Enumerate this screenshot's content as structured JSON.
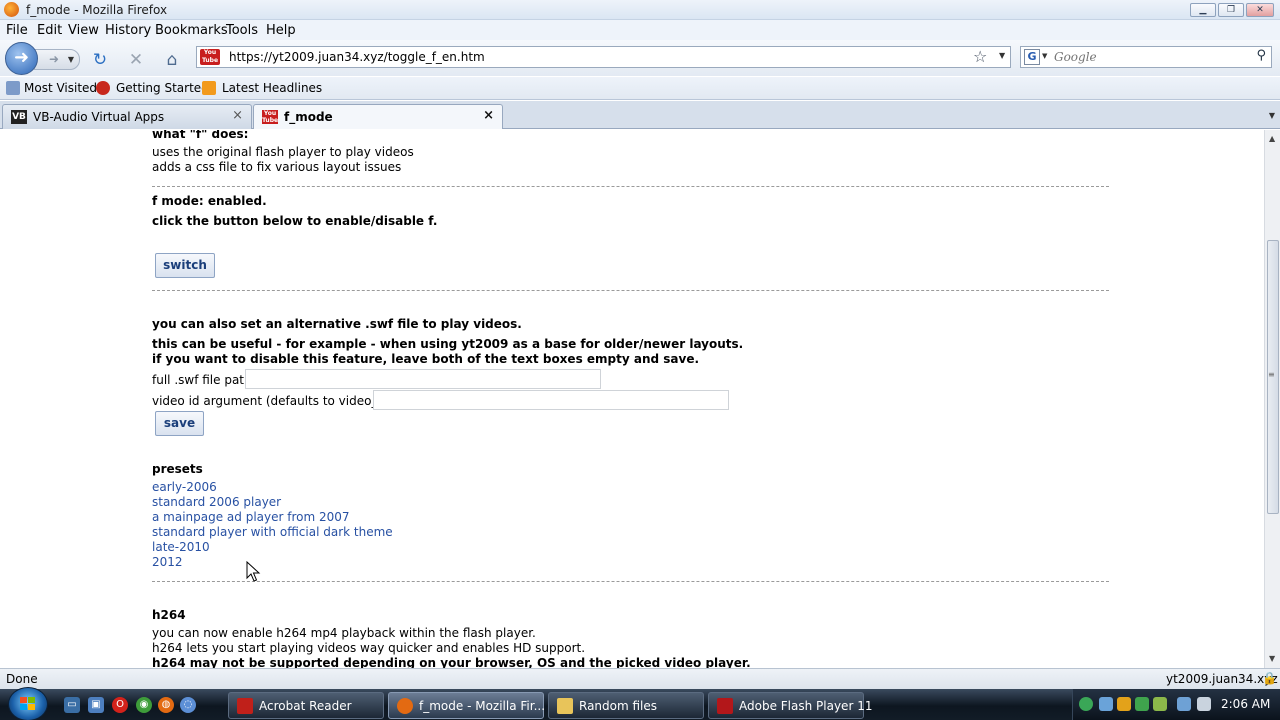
{
  "window": {
    "title": "f_mode - Mozilla Firefox"
  },
  "menu": [
    "File",
    "Edit",
    "View",
    "History",
    "Bookmarks",
    "Tools",
    "Help"
  ],
  "nav": {
    "url": "https://yt2009.juan34.xyz/toggle_f_en.htm",
    "search_placeholder": "Google",
    "favicon_text": "You Tube"
  },
  "bookmarks": [
    "Most Visited",
    "Getting Started",
    "Latest Headlines"
  ],
  "tabs": [
    {
      "label": "VB-Audio Virtual Apps",
      "icon": "VB"
    },
    {
      "label": "f_mode",
      "icon": "You Tube"
    }
  ],
  "content": {
    "what_f_does": "what \"f\" does:",
    "does_1": "uses the original flash player to play videos",
    "does_2": "adds a css file to fix various layout issues",
    "status": "f mode: enabled.",
    "instruction": "click the button below to enable/disable f.",
    "switch_label": "switch",
    "alt_heading": "you can also set an alternative .swf file to play videos.",
    "alt_note_1": "this can be useful - for example - when using yt2009 as a base for older/newer layouts.",
    "alt_note_2": "if you want to disable this feature, leave both of the text boxes empty and save.",
    "swf_path_label": "full .swf file path:",
    "swf_path_value": "",
    "video_id_label": "video id argument (defaults to video_id):",
    "video_id_value": "",
    "save_label": "save",
    "presets_heading": "presets",
    "presets": [
      "early-2006",
      "standard 2006 player",
      "a mainpage ad player from 2007",
      "standard player with official dark theme",
      "late-2010",
      "2012"
    ],
    "h264_heading": "h264",
    "h264_1": "you can now enable h264 mp4 playback within the flash player.",
    "h264_2": "h264 lets you start playing videos way quicker and enables HD support.",
    "h264_3": "h264 may not be supported depending on your browser, OS and the picked video player."
  },
  "status_bar": {
    "left": "Done",
    "right": "yt2009.juan34.xyz"
  },
  "taskbar": {
    "tasks": [
      "Acrobat Reader",
      "f_mode - Mozilla Fir...",
      "Random files",
      "Adobe Flash Player 11"
    ],
    "clock": "2:06 AM"
  },
  "colors": {
    "link": "#2851a3",
    "button_text": "#1a3e7a",
    "taskbar": "#121c27"
  }
}
